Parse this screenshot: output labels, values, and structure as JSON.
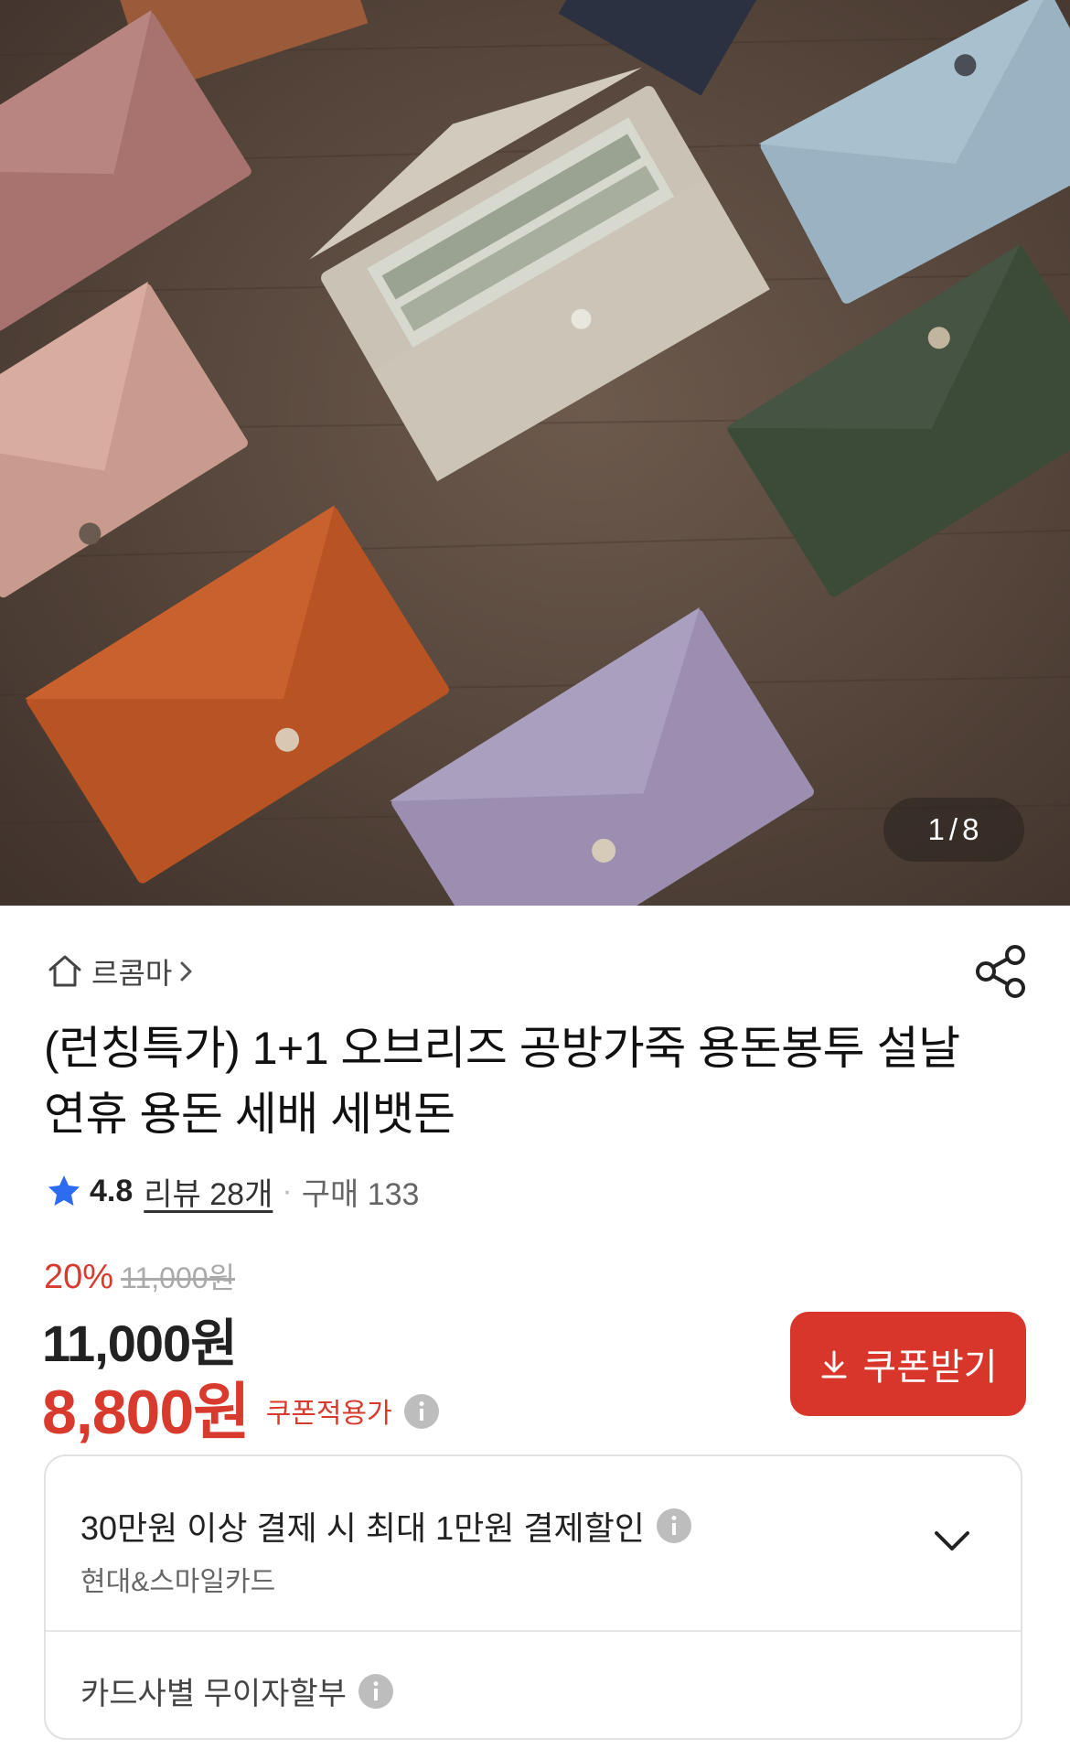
{
  "gallery": {
    "current": "1",
    "separator": "/",
    "total": "8",
    "image_subject": "envelope-wallets"
  },
  "store": {
    "name": "르콤마"
  },
  "product": {
    "title": "(런칭특가) 1+1 오브리즈 공방가죽 용돈봉투 설날 연휴 용돈 세배 세뱃돈",
    "rating": "4.8",
    "review_label": "리뷰 28개",
    "purchase_label": "구매 133"
  },
  "pricing": {
    "discount_rate": "20%",
    "original_price": "11,000원",
    "price": "11,000원",
    "coupon_price": "8,800원",
    "coupon_price_label": "쿠폰적용가",
    "coupon_button_label": "쿠폰받기",
    "accent_color": "#d83a2e"
  },
  "benefits": {
    "card_discount_title": "30만원 이상 결제 시 최대 1만원 결제할인",
    "card_discount_cards": "현대&스마일카드",
    "installment_title": "카드사별 무이자할부"
  },
  "icons": [
    "home-icon",
    "chevron-right-icon",
    "share-icon",
    "star-icon",
    "info-icon",
    "download-icon",
    "chevron-down-icon"
  ]
}
